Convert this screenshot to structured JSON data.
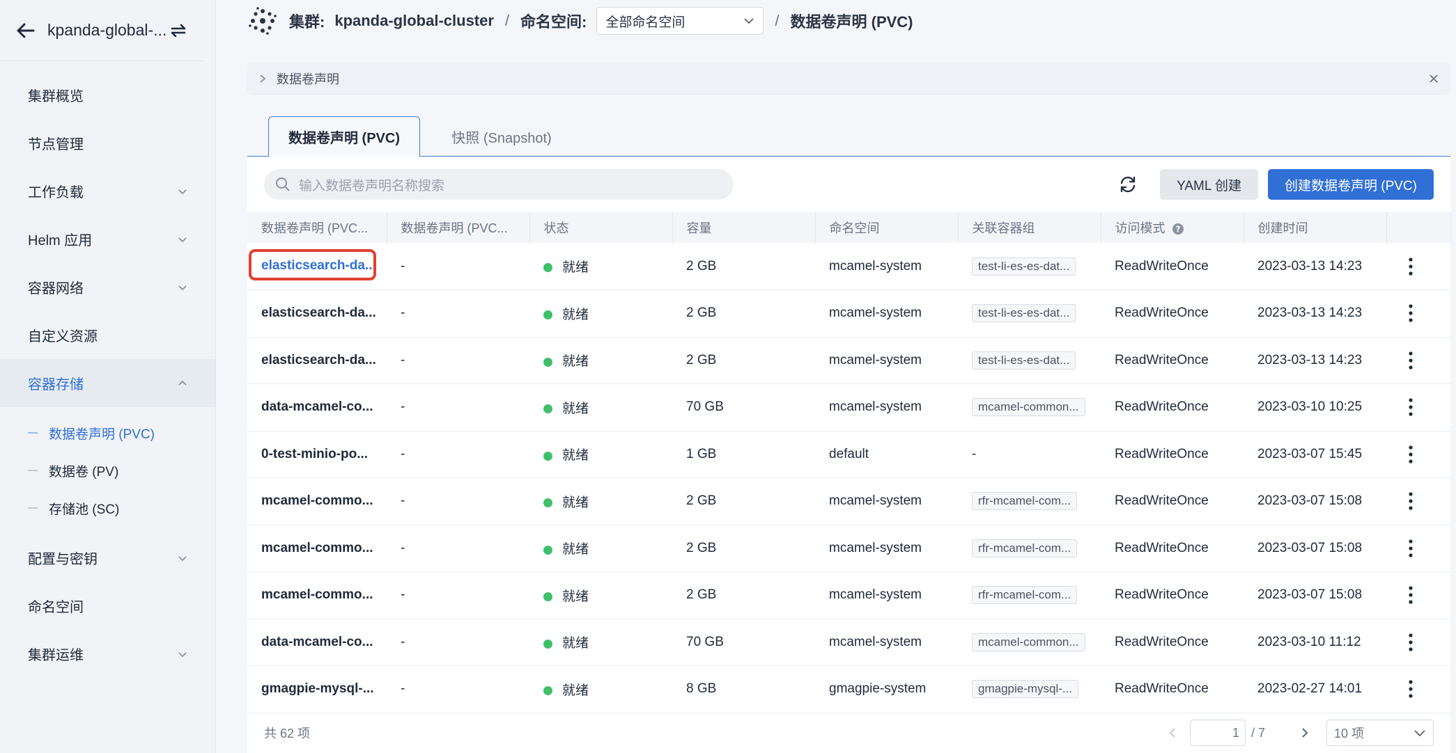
{
  "sidebar": {
    "title": "kpanda-global-...",
    "items": [
      {
        "label": "集群概览",
        "has_chevron": false
      },
      {
        "label": "节点管理",
        "has_chevron": false
      },
      {
        "label": "工作负载",
        "has_chevron": true
      },
      {
        "label": "Helm 应用",
        "has_chevron": true
      },
      {
        "label": "容器网络",
        "has_chevron": true
      },
      {
        "label": "自定义资源",
        "has_chevron": false
      },
      {
        "label": "容器存储",
        "has_chevron": true,
        "expanded": true
      }
    ],
    "subitems": [
      {
        "label": "数据卷声明 (PVC)",
        "active": true
      },
      {
        "label": "数据卷 (PV)",
        "active": false
      },
      {
        "label": "存储池 (SC)",
        "active": false
      }
    ],
    "items_after": [
      {
        "label": "配置与密钥",
        "has_chevron": true
      },
      {
        "label": "命名空间",
        "has_chevron": false
      },
      {
        "label": "集群运维",
        "has_chevron": true
      }
    ]
  },
  "topbar": {
    "cluster_prefix": "集群:",
    "cluster_name": "kpanda-global-cluster",
    "namespace_prefix": "命名空间:",
    "namespace_value": "全部命名空间",
    "page": "数据卷声明 (PVC)"
  },
  "notice": {
    "label": "数据卷声明"
  },
  "tabs": {
    "active": "数据卷声明 (PVC)",
    "inactive": "快照 (Snapshot)"
  },
  "toolbar": {
    "search_placeholder": "输入数据卷声明名称搜索",
    "yaml_button": "YAML 创建",
    "create_button": "创建数据卷声明 (PVC)"
  },
  "table": {
    "headers": [
      "数据卷声明 (PVC...",
      "数据卷声明 (PVC...",
      "状态",
      "容量",
      "命名空间",
      "关联容器组",
      "访问模式",
      "创建时间"
    ],
    "rows": [
      {
        "name": "elasticsearch-da...",
        "alias": "-",
        "status": "就绪",
        "capacity": "2 GB",
        "namespace": "mcamel-system",
        "pod": "test-li-es-es-dat...",
        "mode": "ReadWriteOnce",
        "created": "2023-03-13 14:23"
      },
      {
        "name": "elasticsearch-da...",
        "alias": "-",
        "status": "就绪",
        "capacity": "2 GB",
        "namespace": "mcamel-system",
        "pod": "test-li-es-es-dat...",
        "mode": "ReadWriteOnce",
        "created": "2023-03-13 14:23"
      },
      {
        "name": "elasticsearch-da...",
        "alias": "-",
        "status": "就绪",
        "capacity": "2 GB",
        "namespace": "mcamel-system",
        "pod": "test-li-es-es-dat...",
        "mode": "ReadWriteOnce",
        "created": "2023-03-13 14:23"
      },
      {
        "name": "data-mcamel-co...",
        "alias": "-",
        "status": "就绪",
        "capacity": "70 GB",
        "namespace": "mcamel-system",
        "pod": "mcamel-common...",
        "mode": "ReadWriteOnce",
        "created": "2023-03-10 10:25"
      },
      {
        "name": "0-test-minio-po...",
        "alias": "-",
        "status": "就绪",
        "capacity": "1 GB",
        "namespace": "default",
        "pod": "-",
        "mode": "ReadWriteOnce",
        "created": "2023-03-07 15:45"
      },
      {
        "name": "mcamel-commo...",
        "alias": "-",
        "status": "就绪",
        "capacity": "2 GB",
        "namespace": "mcamel-system",
        "pod": "rfr-mcamel-com...",
        "mode": "ReadWriteOnce",
        "created": "2023-03-07 15:08"
      },
      {
        "name": "mcamel-commo...",
        "alias": "-",
        "status": "就绪",
        "capacity": "2 GB",
        "namespace": "mcamel-system",
        "pod": "rfr-mcamel-com...",
        "mode": "ReadWriteOnce",
        "created": "2023-03-07 15:08"
      },
      {
        "name": "mcamel-commo...",
        "alias": "-",
        "status": "就绪",
        "capacity": "2 GB",
        "namespace": "mcamel-system",
        "pod": "rfr-mcamel-com...",
        "mode": "ReadWriteOnce",
        "created": "2023-03-07 15:08"
      },
      {
        "name": "data-mcamel-co...",
        "alias": "-",
        "status": "就绪",
        "capacity": "70 GB",
        "namespace": "mcamel-system",
        "pod": "mcamel-common...",
        "mode": "ReadWriteOnce",
        "created": "2023-03-10 11:12"
      },
      {
        "name": "gmagpie-mysql-...",
        "alias": "-",
        "status": "就绪",
        "capacity": "8 GB",
        "namespace": "gmagpie-system",
        "pod": "gmagpie-mysql-...",
        "mode": "ReadWriteOnce",
        "created": "2023-02-27 14:01"
      }
    ]
  },
  "footer": {
    "total": "共 62 项",
    "page_current": "1",
    "page_total": "/ 7",
    "page_size": "10 项"
  },
  "colors": {
    "accent": "#2f6fd6",
    "status_ready": "#3fbf6a",
    "highlight": "#e0412f"
  }
}
